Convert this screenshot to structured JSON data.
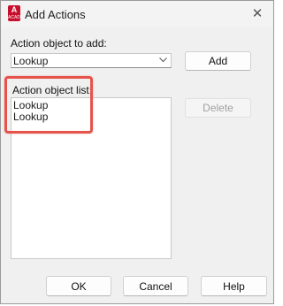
{
  "window": {
    "title": "Add Actions",
    "app_icon_letter": "A",
    "app_icon_sub": "ACAD",
    "close_glyph": "✕"
  },
  "form": {
    "object_to_add_label": "Action object to add:",
    "object_to_add_value": "Lookup",
    "add_button": "Add",
    "object_list_label": "Action object list:",
    "object_list": [
      "Lookup",
      "Lookup"
    ],
    "delete_button": "Delete"
  },
  "footer": {
    "ok_button": "OK",
    "cancel_button": "Cancel",
    "help_button": "Help"
  },
  "colors": {
    "highlight": "#e5534b",
    "app_icon": "#c8102e"
  },
  "icons": {
    "close": "close-icon",
    "dropdown": "chevron-down-icon",
    "app": "autocad-app-icon"
  }
}
